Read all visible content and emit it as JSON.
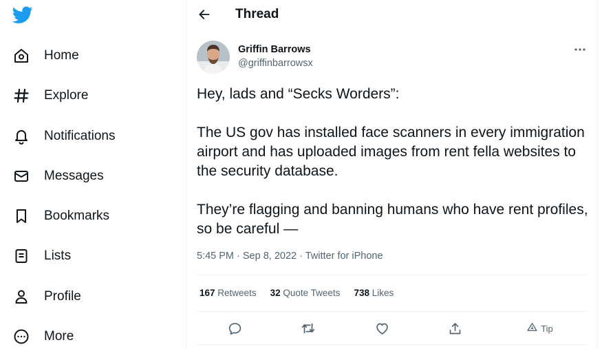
{
  "sidebar": {
    "logo_icon": "twitter-bird-icon",
    "brand_color": "#1d9bf0",
    "items": [
      {
        "label": "Home",
        "icon": "home-icon"
      },
      {
        "label": "Explore",
        "icon": "hashtag-icon"
      },
      {
        "label": "Notifications",
        "icon": "bell-icon"
      },
      {
        "label": "Messages",
        "icon": "envelope-icon"
      },
      {
        "label": "Bookmarks",
        "icon": "bookmark-icon"
      },
      {
        "label": "Lists",
        "icon": "list-icon"
      },
      {
        "label": "Profile",
        "icon": "person-icon"
      },
      {
        "label": "More",
        "icon": "more-circle-icon"
      }
    ]
  },
  "header": {
    "title": "Thread",
    "back_icon": "arrow-left-icon"
  },
  "tweet": {
    "author_name": "Griffin Barrows",
    "author_handle": "@griffinbarrowsx",
    "paragraphs": [
      "Hey, lads and “Secks Worders”:",
      "The US gov has installed face scanners in every immigration airport and has uploaded images from rent fella websites to the security database.",
      "They’re flagging and banning humans who have rent profiles, so be careful —"
    ],
    "time": "5:45 PM",
    "date": "Sep 8, 2022",
    "source": "Twitter for iPhone",
    "separator": " · "
  },
  "stats": {
    "retweets_count": "167",
    "retweets_label": "Retweets",
    "quotes_count": "32",
    "quotes_label": "Quote Tweets",
    "likes_count": "738",
    "likes_label": "Likes"
  },
  "actions": {
    "tip_label": "Tip",
    "icons": [
      "reply-icon",
      "retweet-icon",
      "like-icon",
      "share-icon",
      "tip-icon"
    ]
  },
  "colors": {
    "text_primary": "#0f1419",
    "text_secondary": "#536471",
    "divider": "#eff3f4"
  }
}
